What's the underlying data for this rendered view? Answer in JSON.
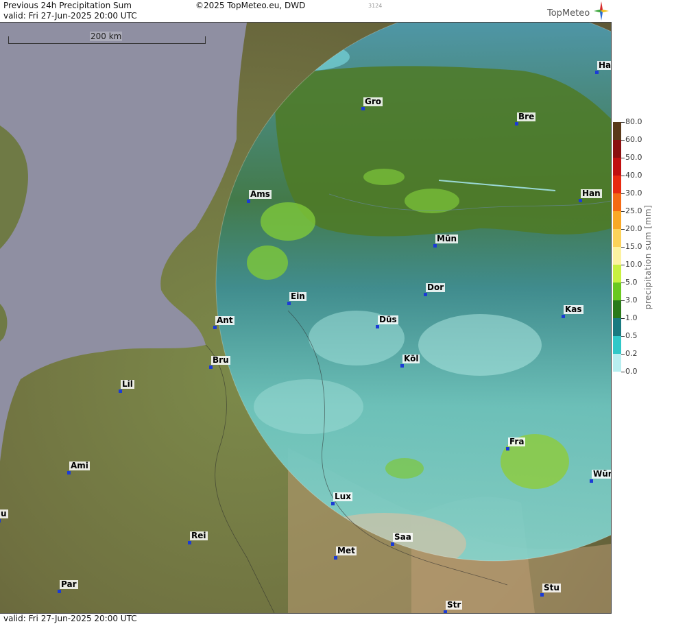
{
  "header": {
    "title": "Previous 24h Precipitation Sum",
    "valid": "valid:  Fri  27-Jun-2025 20:00 UTC",
    "copyright": "©2025 TopMeteo.eu, DWD",
    "code": "3124",
    "brand": "TopMeteo"
  },
  "footer": {
    "valid": "valid:  Fri  27-Jun-2025 20:00 UTC"
  },
  "scale": {
    "label": "200 km"
  },
  "cities": [
    {
      "name": "Ha"
    },
    {
      "name": "Gro"
    },
    {
      "name": "Bre"
    },
    {
      "name": "Ams"
    },
    {
      "name": "Han"
    },
    {
      "name": "Mün"
    },
    {
      "name": "Ein"
    },
    {
      "name": "Dor"
    },
    {
      "name": "Kas"
    },
    {
      "name": "Ant"
    },
    {
      "name": "Düs"
    },
    {
      "name": "Bru"
    },
    {
      "name": "Köl"
    },
    {
      "name": "Lil"
    },
    {
      "name": "Fra"
    },
    {
      "name": "Ami"
    },
    {
      "name": "Wür"
    },
    {
      "name": "Lux"
    },
    {
      "name": "u"
    },
    {
      "name": "Rei"
    },
    {
      "name": "Saa"
    },
    {
      "name": "Met"
    },
    {
      "name": "Stu"
    },
    {
      "name": "Par"
    },
    {
      "name": "Str"
    }
  ],
  "legend": {
    "title": "precipitation sum [mm]",
    "entries": [
      {
        "value": "80.0",
        "color": "#5a3a1a"
      },
      {
        "value": "60.0",
        "color": "#8a1010"
      },
      {
        "value": "50.0",
        "color": "#c01010"
      },
      {
        "value": "40.0",
        "color": "#e82a10"
      },
      {
        "value": "30.0",
        "color": "#f46a14"
      },
      {
        "value": "25.0",
        "color": "#f9a826"
      },
      {
        "value": "20.0",
        "color": "#fcd25a"
      },
      {
        "value": "15.0",
        "color": "#fdf2a0"
      },
      {
        "value": "10.0",
        "color": "#c8f040"
      },
      {
        "value": "5.0",
        "color": "#6ac820"
      },
      {
        "value": "3.0",
        "color": "#2a7a1a"
      },
      {
        "value": "1.0",
        "color": "#1a7a80"
      },
      {
        "value": "0.5",
        "color": "#30c8c8"
      },
      {
        "value": "0.2",
        "color": "#b8eef0"
      },
      {
        "value": "0.0",
        "color": "#ffffff"
      }
    ]
  },
  "colors": {
    "sea": "#8f8fa2",
    "land": "#6b6a3e",
    "city_marker": "#1b3bd6",
    "radar_light": "#7fd6d0",
    "radar_mid": "#3aa6a8",
    "radar_green": "#4f7a2a",
    "radar_bright": "#7ec83a"
  }
}
